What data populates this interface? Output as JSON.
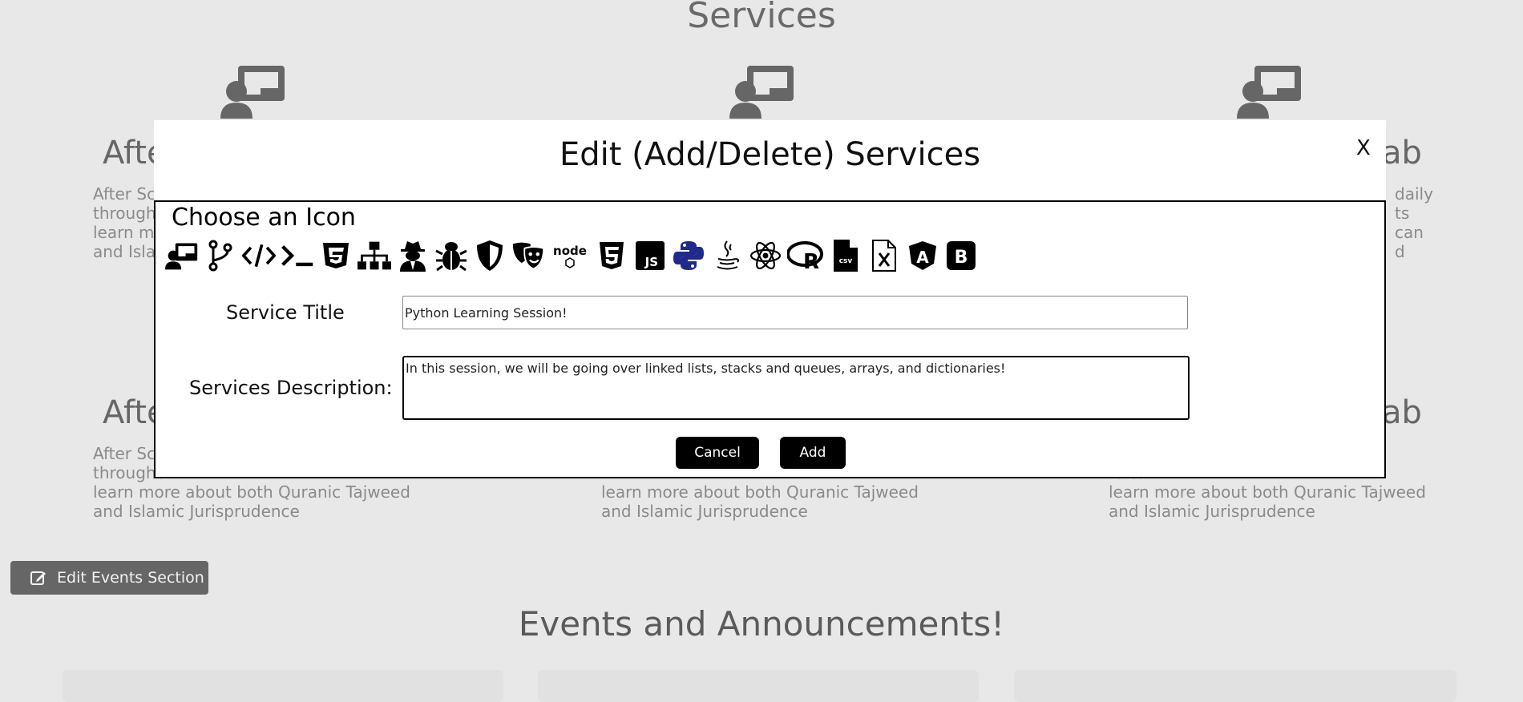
{
  "services": {
    "title": "Services",
    "cards_top": [
      {
        "title": "Afte",
        "desc": "After Sch\nthroughe\nlearn mo\nand Islan"
      },
      {
        "title": "",
        "desc": ""
      },
      {
        "title": "ab",
        "desc": "daily\nts can\nd"
      }
    ],
    "cards_bottom": [
      {
        "title": "Afte",
        "desc": "After Sch\nthroughe\nlearn more about both Quranic Tajweed\nand Islamic Jurisprudence"
      },
      {
        "title": "",
        "desc": "learn more about both Quranic Tajweed\nand Islamic Jurisprudence"
      },
      {
        "title": "ab",
        "desc": "daily\nts can\nlearn more about both Quranic Tajweed\nand Islamic Jurisprudence"
      }
    ]
  },
  "edit_events_button": {
    "label": "Edit Events Section",
    "icon": "edit-icon"
  },
  "events": {
    "title": "Events and Announcements!"
  },
  "modal": {
    "title": "Edit (Add/Delete) Services",
    "close_label": "X",
    "choose_icon_label": "Choose an Icon",
    "icons": [
      "chalkboard-teacher-icon",
      "code-branch-icon",
      "code-icon",
      "terminal-icon",
      "css3-icon",
      "sitemap-icon",
      "user-secret-icon",
      "bug-icon",
      "shield-icon",
      "masks-theater-icon",
      "nodejs-icon",
      "html5-icon",
      "js-icon",
      "python-icon",
      "java-icon",
      "react-icon",
      "r-project-icon",
      "file-csv-icon",
      "file-excel-icon",
      "angular-icon",
      "bootstrap-icon"
    ],
    "icon_text": {
      "nodejs": "node",
      "js": "JS",
      "csv": "csv",
      "r": "R",
      "bootstrap": "B",
      "angular": "A"
    },
    "service_title_label": "Service Title",
    "service_title_value": "Python Learning Session!",
    "services_description_label": "Services Description:",
    "services_description_value": "In this session, we will be going over linked lists, stacks and queues, arrays, and dictionaries!",
    "cancel_label": "Cancel",
    "add_label": "Add"
  },
  "colors": {
    "background": "#e8e8e8",
    "modal": "#ffffff",
    "button": "#000000",
    "python_blue": "#1e2a8c"
  }
}
